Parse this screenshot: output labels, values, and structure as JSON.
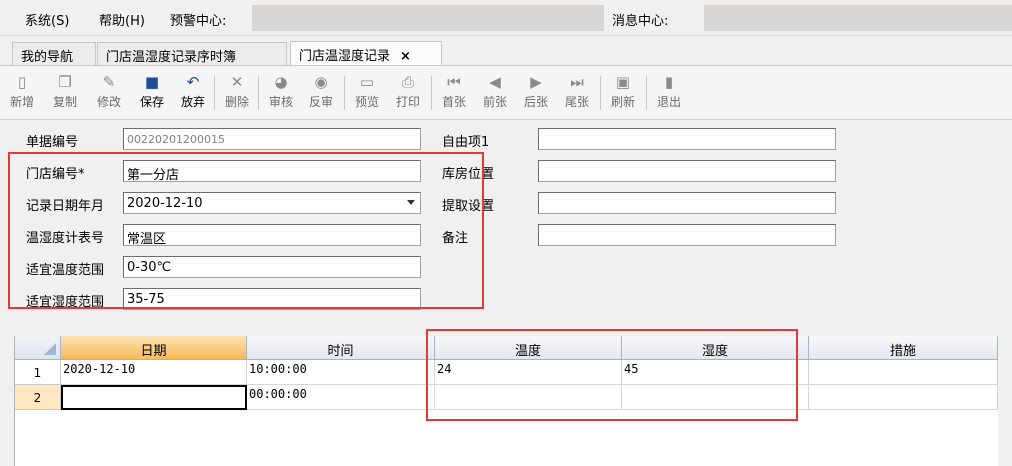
{
  "menu": {
    "system": "系统(S)",
    "help": "帮助(H)",
    "alert_center": "预警中心:",
    "message_center": "消息中心:"
  },
  "tabs": [
    {
      "label": "我的导航"
    },
    {
      "label": "门店温湿度记录序时簿"
    },
    {
      "label": "门店温湿度记录",
      "close": "×"
    }
  ],
  "toolbar": {
    "new": "新增",
    "copy": "复制",
    "edit": "修改",
    "save": "保存",
    "discard": "放弃",
    "delete": "删除",
    "audit": "审核",
    "unaudit": "反审",
    "preview": "预览",
    "print": "打印",
    "first": "首张",
    "prev": "前张",
    "next": "后张",
    "last": "尾张",
    "refresh": "刷新",
    "exit": "退出",
    "icons": {
      "new": "new-document-icon",
      "copy": "copy-icon",
      "edit": "edit-icon",
      "save": "save-icon",
      "discard": "undo-icon",
      "delete": "delete-icon",
      "audit": "audit-icon",
      "unaudit": "unaudit-icon",
      "preview": "preview-icon",
      "print": "print-icon",
      "first": "first-icon",
      "prev": "prev-icon",
      "next": "next-icon",
      "last": "last-icon",
      "refresh": "refresh-icon",
      "exit": "exit-icon"
    }
  },
  "form": {
    "doc_no": {
      "label": "单据编号",
      "value": "00220201200015"
    },
    "store_no": {
      "label": "门店编号*",
      "value": "第一分店"
    },
    "record_date": {
      "label": "记录日期年月",
      "value": "2020-12-10"
    },
    "meter_no": {
      "label": "温湿度计表号",
      "value": "常温区"
    },
    "temp_range": {
      "label": "适宜温度范围",
      "value": "0-30℃"
    },
    "humidity_range": {
      "label": "适宜湿度范围",
      "value": "35-75"
    },
    "custom1": {
      "label": "自由项1",
      "value": ""
    },
    "location": {
      "label": "库房位置",
      "value": ""
    },
    "fetch_settings": {
      "label": "提取设置",
      "value": ""
    },
    "remark": {
      "label": "备注",
      "value": ""
    }
  },
  "grid": {
    "columns": [
      "日期",
      "时间",
      "温度",
      "湿度",
      "措施"
    ],
    "rows": [
      {
        "no": "1",
        "date": "2020-12-10",
        "time": "10:00:00",
        "temp": "24",
        "humidity": "45",
        "measure": ""
      },
      {
        "no": "2",
        "date": "",
        "time": "00:00:00",
        "temp": "",
        "humidity": "",
        "measure": ""
      }
    ]
  },
  "colors": {
    "highlight": "#e23a3a",
    "selected_header": "#f5b957"
  }
}
